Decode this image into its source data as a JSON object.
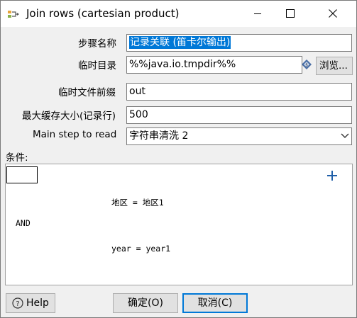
{
  "window": {
    "title": "Join rows (cartesian product)"
  },
  "form": {
    "step_name_label": "步骤名称",
    "step_name_value": "记录关联 (笛卡尔输出)",
    "temp_dir_label": "临时目录",
    "temp_dir_value": "%%java.io.tmpdir%%",
    "browse_label": "浏览...",
    "temp_prefix_label": "临时文件前缀",
    "temp_prefix_value": "out",
    "max_cache_label": "最大缓存大小(记录行)",
    "max_cache_value": "500",
    "main_step_label": "Main step to read",
    "main_step_value": "字符串清洗 2"
  },
  "conditions": {
    "label": "条件:",
    "cond1": "地区 = 地区1",
    "operator": "AND",
    "cond2": "year = year1"
  },
  "buttons": {
    "help": "Help",
    "ok": "确定(O)",
    "cancel": "取消(C)"
  },
  "icons": {
    "app": "transform-icon",
    "variable": "variable-diamond-icon",
    "add": "plus-icon",
    "help": "question-circle-icon"
  },
  "colors": {
    "selection": "#0078d7",
    "add_icon": "#1f5fa8"
  }
}
